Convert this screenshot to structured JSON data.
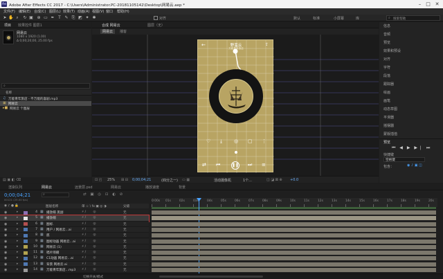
{
  "app": {
    "title": "Adobe After Effects CC 2017 - C:\\Users\\Administrator.PC-20181105142\\Desktop\\网易云.aep *",
    "window_controls": [
      "–",
      "□",
      "✕"
    ]
  },
  "menu": [
    "文件(F)",
    "编辑(E)",
    "合成(C)",
    "图层(L)",
    "效果(T)",
    "动画(A)",
    "视图(V)",
    "窗口",
    "帮助(H)"
  ],
  "toolbar": {
    "snap_label": "对齐",
    "workspaces": [
      "默认",
      "标准",
      "小屏幕",
      "库"
    ],
    "search_placeholder": "搜索帮助"
  },
  "project_panel": {
    "tabs": [
      "项目",
      "效果控件 图层1"
    ],
    "selected_comp": "网易云",
    "comp_info": [
      "1080 x 1920 (1.00)",
      "Δ 0;00;20;00, 25.00 fps"
    ],
    "search_placeholder": "",
    "column_name": "名称",
    "items": [
      "万能青年旅店 - 不万能的喜剧.mp3",
      "网易云",
      "网易云 个图层"
    ]
  },
  "viewer": {
    "tabs": [
      "合成 网易云",
      "图层（无）"
    ],
    "comp_tab": "网易云",
    "comp_tab2": "播客",
    "phone_title": "野蛮云",
    "phone_subtitle": "万能青年旅店",
    "footer": [
      "25%",
      "0;00;04;21",
      "(四分之一)",
      "活动摄像机",
      "1个...",
      "+0.0"
    ]
  },
  "right_panel": {
    "items": [
      "信息",
      "音频",
      "预览",
      "效果和预设",
      "对齐",
      "字符",
      "段落",
      "跟踪器",
      "绘画",
      "画笔",
      "动态草图",
      "平滑器",
      "摇摆器",
      "蒙版插值"
    ],
    "preview_label": "预览",
    "shortcut_label": "快捷键",
    "shortcut_value": "空格键",
    "include_label": "包含："
  },
  "timeline": {
    "tabs": [
      "渲染队列",
      "网易云",
      "远景层.psd",
      "网易云",
      "播放速度",
      "背景"
    ],
    "active_tab": "网易云",
    "timecode": "0;00;04;21",
    "timecode_sub": "00121 (25.00 fps)",
    "columns": {
      "name": "图层名称",
      "switches": "单 ☆ \\ fx ▣ ◎ ◑",
      "parent": "父级"
    },
    "ruler": [
      "0:00s",
      "01s",
      "02s",
      "03s",
      "04s",
      "05s",
      "06s",
      "07s",
      "08s",
      "09s",
      "10s",
      "11s",
      "12s",
      "13s",
      "14s",
      "15s",
      "16s",
      "17s",
      "18s",
      "19s",
      "20s"
    ],
    "layers": [
      {
        "num": "4",
        "name": "播放帽 黑副",
        "parent": "无",
        "color": "#8a6fb2"
      },
      {
        "num": "5",
        "name": "播放帽",
        "parent": "无",
        "color": "#e6e6e6",
        "selected": true
      },
      {
        "num": "6",
        "name": "图标.",
        "parent": "无",
        "color": "#b24f4f"
      },
      {
        "num": "7",
        "name": "用户 / 网易云...ai",
        "parent": "无",
        "color": "#4f78b2"
      },
      {
        "num": "8",
        "name": "底",
        "parent": "无",
        "color": "#4f78b2"
      },
      {
        "num": "9",
        "name": "图标动画 网易云...ai",
        "parent": "无",
        "color": "#4f78b2"
      },
      {
        "num": "10",
        "name": "网易云 (1)",
        "parent": "无",
        "color": "#b2a34f"
      },
      {
        "num": "11",
        "name": "唱片喷播",
        "parent": "无",
        "color": "#b2a34f"
      },
      {
        "num": "12",
        "name": "C1动画 网易云...ai",
        "parent": "无",
        "color": "#4f78b2"
      },
      {
        "num": "13",
        "name": "背景 网易云.ai",
        "parent": "无",
        "color": "#4f78b2"
      },
      {
        "num": "14",
        "name": "万能青年旅店...mp3",
        "parent": "无",
        "color": "#9a9a9a"
      }
    ],
    "footer_label": "切换开关/模式"
  },
  "colors": {
    "accent": "#2d8cf0",
    "comp_gold": "#b8a463",
    "timeline_bar": "#7c786c",
    "playhead": "#4aa3ff"
  }
}
